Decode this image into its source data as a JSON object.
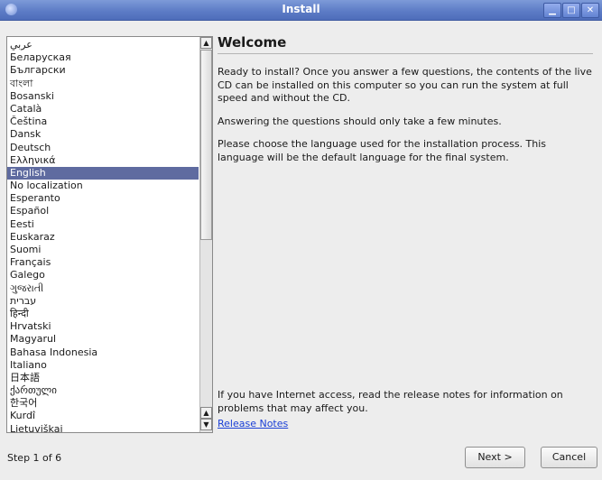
{
  "window": {
    "title": "Install"
  },
  "window_controls": {
    "minimize": "▁",
    "maximize": "□",
    "close": "✕"
  },
  "languages": [
    "عربي",
    "Беларуская",
    "Български",
    "বাংলা",
    "Bosanski",
    "Català",
    "Čeština",
    "Dansk",
    "Deutsch",
    "Ελληνικά",
    "English",
    "No localization",
    "Esperanto",
    "Español",
    "Eesti",
    "Euskaraz",
    "Suomi",
    "Français",
    "Galego",
    "ગુજરાતી",
    "עברית",
    "हिन्दी",
    "Hrvatski",
    "Magyarul",
    "Bahasa Indonesia",
    "Italiano",
    "日本語",
    "ქართული",
    "한국어",
    "Kurdî",
    "Lietuviškai"
  ],
  "selected_language": "English",
  "scrollbar": {
    "up_arrow": "▲",
    "down_arrow": "▼"
  },
  "welcome": {
    "heading": "Welcome",
    "paragraph_1": "Ready to install? Once you answer a few questions, the contents of the live CD can be installed on this computer so you can run the system at full speed and without the CD.",
    "paragraph_2": "Answering the questions should only take a few minutes.",
    "paragraph_3": "Please choose the language used for the installation process. This language will be the default language for the final system."
  },
  "release_info": {
    "text": "If you have Internet access, read the release notes for information on problems that may affect you.",
    "link_label": "Release Notes"
  },
  "footer": {
    "step_text": "Step 1 of 6",
    "next_label": "Next >",
    "cancel_label": "Cancel"
  }
}
